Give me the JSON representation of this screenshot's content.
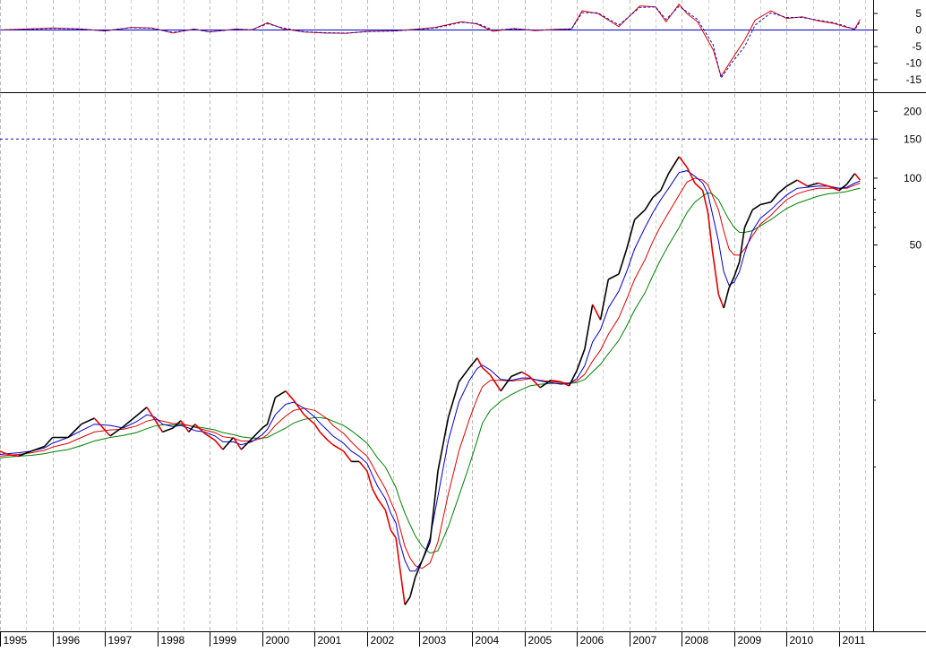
{
  "chart_data": [
    {
      "panel": "oscillator",
      "type": "line",
      "y_ticks": [
        "5",
        "0",
        "-5",
        "-10",
        "-15"
      ],
      "y_tick_values": [
        5,
        0,
        -5,
        -10,
        -15
      ],
      "ylim": [
        -18,
        8
      ],
      "zero_line": true,
      "series": [
        {
          "style": "red-solid",
          "color": "#e00000"
        },
        {
          "style": "blue-dashed",
          "color": "#1010c8"
        }
      ],
      "x": [
        1995.0,
        1995.5,
        1996.0,
        1996.5,
        1997.0,
        1997.5,
        1997.9,
        1998.3,
        1998.7,
        1999.0,
        1999.5,
        1999.8,
        2000.1,
        2000.4,
        2000.8,
        2001.2,
        2001.6,
        2002.0,
        2002.5,
        2002.9,
        2003.3,
        2003.8,
        2004.1,
        2004.4,
        2004.8,
        2005.2,
        2005.6,
        2005.9,
        2006.1,
        2006.4,
        2006.8,
        2007.2,
        2007.5,
        2007.7,
        2007.95,
        2008.1,
        2008.3,
        2008.6,
        2008.75,
        2008.95,
        2009.2,
        2009.4,
        2009.7,
        2010.0,
        2010.3,
        2010.6,
        2010.9,
        2011.1,
        2011.3,
        2011.4
      ],
      "values": [
        0.0,
        0.3,
        0.6,
        0.4,
        -0.3,
        0.8,
        0.6,
        -0.9,
        0.3,
        -0.6,
        0.3,
        0.0,
        2.2,
        0.4,
        -0.6,
        -0.9,
        -1.0,
        -0.4,
        -0.3,
        0.2,
        0.8,
        2.5,
        1.8,
        -0.4,
        0.5,
        -0.2,
        0.2,
        0.4,
        5.8,
        5.0,
        1.0,
        7.3,
        7.0,
        2.5,
        7.8,
        5.0,
        2.5,
        -6.0,
        -14.0,
        -9.0,
        -3.0,
        3.0,
        5.8,
        3.5,
        4.0,
        2.8,
        2.0,
        1.0,
        0.3,
        3.2
      ],
      "values_secondary": [
        0.0,
        0.2,
        0.5,
        0.3,
        -0.2,
        0.7,
        0.5,
        -0.7,
        0.2,
        -0.5,
        0.2,
        0.1,
        1.9,
        0.6,
        -0.5,
        -0.8,
        -0.9,
        -0.5,
        -0.3,
        0.1,
        0.6,
        2.3,
        2.0,
        0.0,
        0.3,
        0.0,
        0.1,
        0.3,
        5.2,
        5.2,
        1.5,
        6.8,
        7.0,
        3.2,
        7.2,
        5.5,
        3.2,
        -4.5,
        -14.5,
        -10.0,
        -5.0,
        1.5,
        5.2,
        3.8,
        3.8,
        3.0,
        2.2,
        1.3,
        0.1,
        2.6
      ]
    },
    {
      "panel": "price",
      "type": "line",
      "log_scale": true,
      "y_ticks": [
        "200",
        "150",
        "100",
        "50"
      ],
      "y_tick_values": [
        200,
        150,
        100,
        50
      ],
      "ylim": [
        1,
        220
      ],
      "reference_line": {
        "value": 150,
        "style": "blue-dashed",
        "color": "#1010c8"
      },
      "x_ticks": [
        "1995",
        "1996",
        "1997",
        "1998",
        "1999",
        "2000",
        "2001",
        "2002",
        "2003",
        "2004",
        "2005",
        "2006",
        "2007",
        "2008",
        "2009",
        "2010",
        "2011"
      ],
      "x_tick_values": [
        1995,
        1996,
        1997,
        1998,
        1999,
        2000,
        2001,
        2002,
        2003,
        2004,
        2005,
        2006,
        2007,
        2008,
        2009,
        2010,
        2011
      ],
      "x_range": [
        1995.0,
        2011.65
      ],
      "grid": "vertical dashed",
      "series": [
        {
          "style": "price",
          "color": "#000000",
          "down_color": "#e00000"
        },
        {
          "style": "ma-short",
          "color": "#0000cc"
        },
        {
          "style": "ma-medium",
          "color": "#dd0000"
        },
        {
          "style": "ma-long",
          "color": "#008000"
        }
      ],
      "x": [
        1995.0,
        1995.15,
        1995.35,
        1995.6,
        1995.85,
        1996.0,
        1996.3,
        1996.55,
        1996.8,
        1997.1,
        1997.35,
        1997.6,
        1997.8,
        1997.95,
        1998.1,
        1998.3,
        1998.45,
        1998.6,
        1998.72,
        1998.9,
        1999.1,
        1999.25,
        1999.45,
        1999.6,
        1999.8,
        2000.0,
        2000.1,
        2000.25,
        2000.45,
        2000.6,
        2000.8,
        2001.0,
        2001.1,
        2001.25,
        2001.35,
        2001.55,
        2001.7,
        2001.85,
        2002.0,
        2002.1,
        2002.2,
        2002.35,
        2002.45,
        2002.55,
        2002.62,
        2002.72,
        2002.82,
        2002.92,
        2003.05,
        2003.2,
        2003.35,
        2003.55,
        2003.75,
        2003.95,
        2004.1,
        2004.2,
        2004.35,
        2004.55,
        2004.75,
        2004.95,
        2005.1,
        2005.3,
        2005.5,
        2005.7,
        2005.85,
        2006.0,
        2006.15,
        2006.3,
        2006.45,
        2006.6,
        2006.8,
        2006.95,
        2007.1,
        2007.3,
        2007.45,
        2007.6,
        2007.75,
        2007.95,
        2008.1,
        2008.25,
        2008.4,
        2008.5,
        2008.58,
        2008.7,
        2008.8,
        2008.9,
        2009.0,
        2009.1,
        2009.2,
        2009.35,
        2009.5,
        2009.7,
        2009.85,
        2010.0,
        2010.2,
        2010.4,
        2010.6,
        2010.8,
        2011.0,
        2011.15,
        2011.3,
        2011.4
      ],
      "values": [
        5.9,
        5.7,
        5.6,
        5.9,
        6.2,
        6.8,
        6.8,
        7.8,
        8.3,
        6.9,
        7.6,
        8.5,
        9.3,
        8.2,
        7.2,
        7.5,
        8.1,
        7.2,
        7.8,
        7.1,
        6.6,
        6.0,
        6.8,
        6.0,
        6.7,
        7.5,
        7.8,
        10.3,
        11.0,
        10.0,
        8.6,
        7.8,
        7.2,
        6.6,
        6.3,
        5.9,
        5.3,
        5.3,
        4.8,
        4.0,
        3.6,
        3.2,
        2.6,
        2.4,
        1.8,
        1.2,
        1.3,
        1.6,
        1.9,
        2.3,
        4.8,
        8.4,
        12.1,
        14.0,
        15.5,
        14.0,
        13.0,
        11.0,
        12.8,
        13.4,
        12.8,
        11.4,
        12.3,
        12.1,
        11.6,
        13.6,
        17.0,
        27.0,
        23.0,
        35.0,
        37.0,
        48.0,
        65.0,
        72.0,
        82.0,
        88.0,
        105.0,
        125.0,
        112.0,
        95.0,
        88.0,
        70.0,
        48.0,
        30.0,
        26.0,
        32.0,
        36.0,
        42.0,
        60.0,
        72.0,
        76.0,
        78.0,
        86.0,
        92.0,
        98.0,
        92.0,
        95.0,
        92.0,
        88.0,
        94.0,
        105.0,
        98.0
      ],
      "ma_short": [
        5.7,
        5.75,
        5.8,
        5.9,
        6.1,
        6.4,
        6.8,
        7.3,
        7.8,
        7.7,
        7.5,
        8.0,
        8.6,
        8.4,
        7.8,
        7.6,
        7.7,
        7.5,
        7.3,
        7.2,
        6.9,
        6.5,
        6.5,
        6.3,
        6.5,
        7.0,
        7.4,
        8.6,
        9.6,
        9.8,
        9.2,
        8.4,
        7.9,
        7.3,
        6.9,
        6.4,
        5.9,
        5.6,
        5.2,
        4.6,
        4.1,
        3.6,
        3.1,
        2.8,
        2.3,
        1.9,
        1.7,
        1.7,
        1.9,
        2.4,
        3.7,
        6.6,
        9.8,
        12.3,
        13.9,
        14.4,
        13.7,
        12.4,
        12.3,
        12.6,
        12.6,
        12.2,
        12.0,
        11.8,
        11.9,
        12.5,
        14.3,
        18.3,
        20.8,
        26.0,
        31.0,
        38.0,
        48.0,
        60.0,
        70.0,
        80.0,
        90.0,
        106.0,
        108.0,
        102.0,
        95.0,
        85.0,
        70.0,
        52.0,
        38.0,
        33.0,
        34.0,
        38.0,
        46.0,
        58.0,
        66.0,
        72.0,
        78.0,
        84.0,
        90.0,
        91.0,
        92.0,
        92.0,
        90.0,
        91.0,
        95.0,
        97.0
      ],
      "ma_medium": [
        5.6,
        5.65,
        5.7,
        5.8,
        5.95,
        6.15,
        6.4,
        6.8,
        7.2,
        7.35,
        7.4,
        7.65,
        8.05,
        8.2,
        8.05,
        7.85,
        7.85,
        7.7,
        7.55,
        7.35,
        7.15,
        6.85,
        6.75,
        6.55,
        6.55,
        6.75,
        7.0,
        7.7,
        8.5,
        9.0,
        9.2,
        9.0,
        8.7,
        8.2,
        7.7,
        7.1,
        6.5,
        6.0,
        5.6,
        5.1,
        4.6,
        4.0,
        3.5,
        3.1,
        2.7,
        2.2,
        1.95,
        1.8,
        1.75,
        1.85,
        2.3,
        3.8,
        5.9,
        8.2,
        10.2,
        11.5,
        12.3,
        12.3,
        12.2,
        12.35,
        12.5,
        12.3,
        12.15,
        12.0,
        11.95,
        12.2,
        13.1,
        15.0,
        16.8,
        19.8,
        23.5,
        28.5,
        35.0,
        43.0,
        52.0,
        61.0,
        70.0,
        84.0,
        96.0,
        100.0,
        98.0,
        93.0,
        84.0,
        72.0,
        58.0,
        48.0,
        45.0,
        45.0,
        48.0,
        55.0,
        62.0,
        68.0,
        74.0,
        80.0,
        85.0,
        88.0,
        90.0,
        90.0,
        90.0,
        90.0,
        93.0,
        95.0
      ],
      "ma_long": [
        5.5,
        5.55,
        5.6,
        5.65,
        5.75,
        5.85,
        6.0,
        6.25,
        6.55,
        6.8,
        6.95,
        7.15,
        7.45,
        7.65,
        7.75,
        7.75,
        7.75,
        7.7,
        7.6,
        7.5,
        7.35,
        7.15,
        7.0,
        6.85,
        6.75,
        6.75,
        6.8,
        7.1,
        7.5,
        7.9,
        8.2,
        8.35,
        8.35,
        8.25,
        8.05,
        7.7,
        7.3,
        6.85,
        6.4,
        5.95,
        5.5,
        5.0,
        4.5,
        4.05,
        3.6,
        3.1,
        2.75,
        2.45,
        2.2,
        2.05,
        2.1,
        2.7,
        3.7,
        5.1,
        6.6,
        7.9,
        9.0,
        9.9,
        10.6,
        11.2,
        11.6,
        11.8,
        11.9,
        11.9,
        11.9,
        12.0,
        12.4,
        13.4,
        14.5,
        16.2,
        18.6,
        21.6,
        25.5,
        30.5,
        36.5,
        43.0,
        50.0,
        60.0,
        70.0,
        78.0,
        83.0,
        86.0,
        85.0,
        80.0,
        72.0,
        65.0,
        60.0,
        57.0,
        57.0,
        58.0,
        61.0,
        65.0,
        69.0,
        73.0,
        77.0,
        80.0,
        83.0,
        85.0,
        86.0,
        87.0,
        89.0,
        90.0
      ]
    }
  ]
}
